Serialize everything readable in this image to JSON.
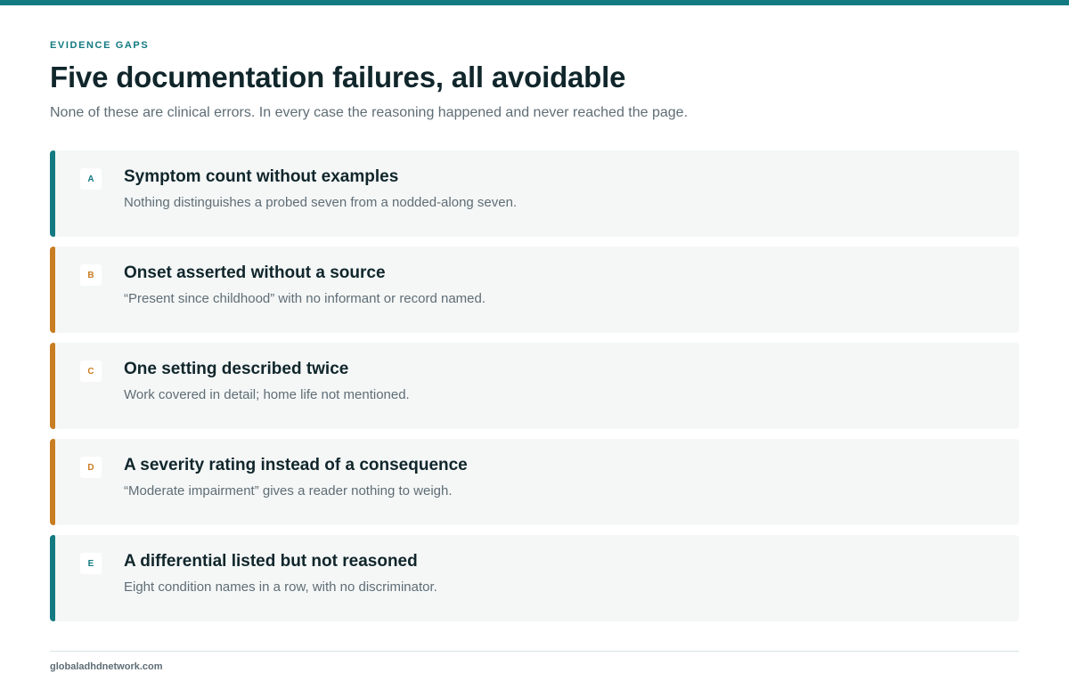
{
  "colors": {
    "teal": "#127a80",
    "amber": "#c97d22",
    "heading": "#10262b",
    "muted": "#5f6d75",
    "card_bg": "#f5f7f7"
  },
  "eyebrow": "EVIDENCE GAPS",
  "title": "Five documentation failures, all avoidable",
  "subtitle": "None of these are clinical errors. In every case the reasoning happened and never reached the page.",
  "cards": [
    {
      "letter": "A",
      "accent": "teal",
      "heading": "Symptom count without examples",
      "body": "Nothing distinguishes a probed seven from a nodded-along seven."
    },
    {
      "letter": "B",
      "accent": "amber",
      "heading": "Onset asserted without a source",
      "body": "“Present since childhood” with no informant or record named."
    },
    {
      "letter": "C",
      "accent": "amber",
      "heading": "One setting described twice",
      "body": "Work covered in detail; home life not mentioned."
    },
    {
      "letter": "D",
      "accent": "amber",
      "heading": "A severity rating instead of a consequence",
      "body": "“Moderate impairment” gives a reader nothing to weigh."
    },
    {
      "letter": "E",
      "accent": "teal",
      "heading": "A differential listed but not reasoned",
      "body": "Eight condition names in a row, with no discriminator."
    }
  ],
  "footer": {
    "site": "globaladhdnetwork.com"
  }
}
